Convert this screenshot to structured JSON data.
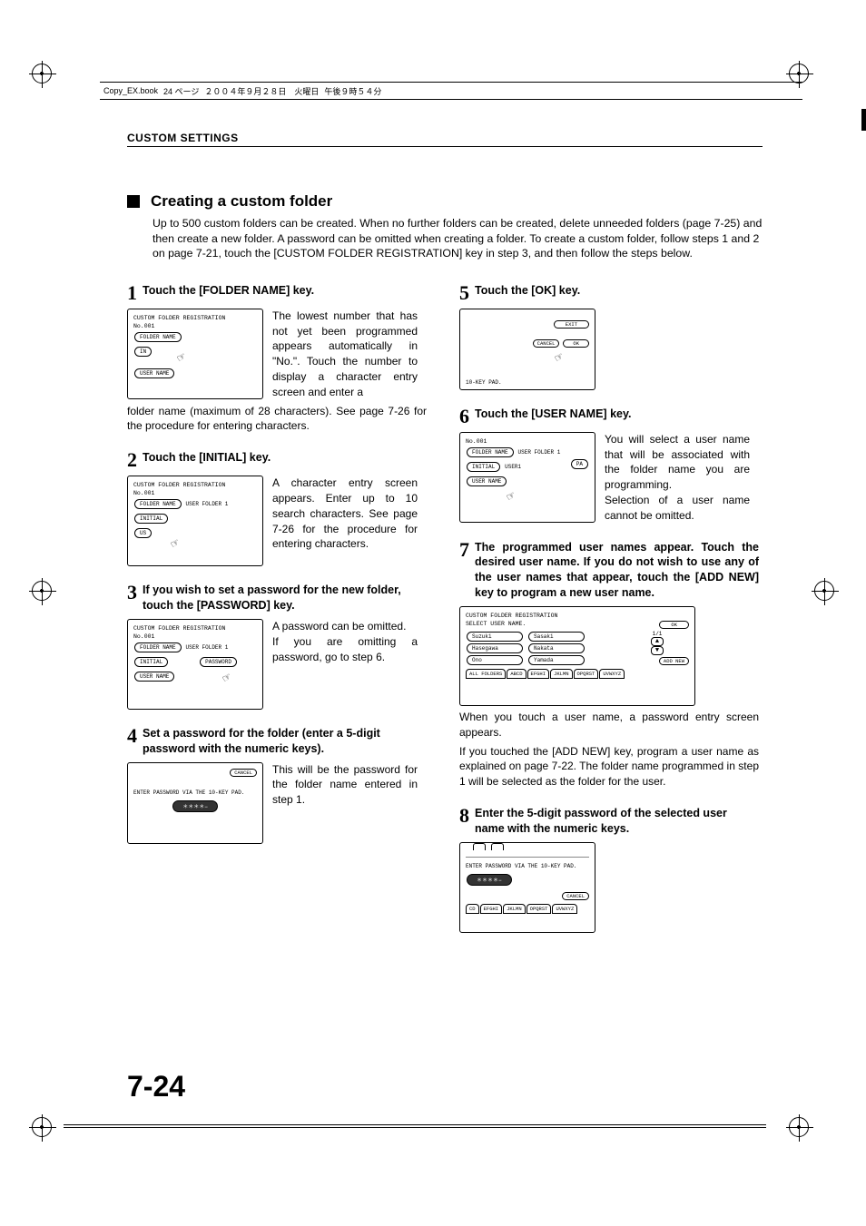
{
  "header": {
    "file": "Copy_EX.book",
    "page_info": "24 ページ",
    "date": "２００４年９月２８日　火曜日",
    "time": "午後９時５４分"
  },
  "section_header": "CUSTOM SETTINGS",
  "heading": "Creating a custom folder",
  "intro": "Up to 500 custom folders can be created. When no further folders can be created, delete unneeded folders (page 7-25) and then create a new folder. A password can be omitted when creating a folder. To create a custom folder, follow steps 1 and 2 on page 7-21, touch the [CUSTOM FOLDER REGISTRATION] key in step 3, and then follow the steps below.",
  "steps": {
    "s1": {
      "num": "1",
      "title": "Touch the [FOLDER NAME] key.",
      "para1": "The lowest number that has not yet been programmed appears automatically in \"No.\". Touch the number to display a character entry screen and enter a",
      "para2": "folder name (maximum of 28 characters). See page 7-26 for the procedure for entering characters.",
      "shot": {
        "title": "CUSTOM FOLDER REGISTRATION",
        "no": "No.001",
        "folder_name": "FOLDER NAME",
        "initial_prefix": "IN",
        "user_name": "USER NAME"
      }
    },
    "s2": {
      "num": "2",
      "title": "Touch the [INITIAL] key.",
      "para": "A character entry screen appears. Enter up to 10 search characters. See page 7-26 for the procedure for entering characters.",
      "shot": {
        "title": "CUSTOM FOLDER REGISTRATION",
        "no": "No.001",
        "folder_name": "FOLDER NAME",
        "folder_value": "USER FOLDER 1",
        "initial": "INITIAL",
        "us_prefix": "US"
      }
    },
    "s3": {
      "num": "3",
      "title": "If you wish to set a password for the new folder, touch the [PASSWORD] key.",
      "para": "A password can be omitted.\nIf you are omitting a password, go to step 6.",
      "shot": {
        "title": "CUSTOM FOLDER REGISTRATION",
        "no": "No.001",
        "folder_name": "FOLDER NAME",
        "folder_value": "USER FOLDER 1",
        "initial": "INITIAL",
        "password": "PASSWORD",
        "user_name": "USER NAME"
      }
    },
    "s4": {
      "num": "4",
      "title": "Set a password for the folder (enter a 5-digit password with the numeric keys).",
      "para": "This will be the password for the folder name entered in step 1.",
      "shot": {
        "cancel": "CANCEL",
        "prompt": "ENTER PASSWORD VIA THE 10-KEY PAD.",
        "stars": "＊＊＊＊−"
      }
    },
    "s5": {
      "num": "5",
      "title": "Touch the [OK] key.",
      "shot": {
        "exit": "EXIT",
        "cancel": "CANCEL",
        "ok": "OK",
        "tenkey": "10-KEY PAD."
      }
    },
    "s6": {
      "num": "6",
      "title": "Touch the [USER NAME] key.",
      "para": "You will select a user name that will be associated with the folder name you are programming.\nSelection of a user name cannot be omitted.",
      "shot": {
        "no": "No.001",
        "folder_name": "FOLDER NAME",
        "folder_value": "USER FOLDER 1",
        "initial": "INITIAL",
        "initial_value": "USER1",
        "pa_suffix": "PA",
        "user_name": "USER NAME"
      }
    },
    "s7": {
      "num": "7",
      "title": "The programmed user names appear. Touch the desired user name. If you do not wish to use any of the user names that appear, touch the [ADD NEW] key to program a new user name.",
      "para1": "When you touch a user name, a password entry screen appears.",
      "para2": "If you touched the [ADD NEW] key, program a user name as explained on page 7-22. The folder name programmed in step 1 will be selected as the folder for the user.",
      "shot": {
        "title": "CUSTOM FOLDER REGISTRATION",
        "subtitle": "SELECT USER NAME.",
        "ok": "OK",
        "users": [
          "Suzuki",
          "Sasaki",
          "Hasegawa",
          "Nakata",
          "Ono",
          "Yamada"
        ],
        "page": "1/1",
        "add_new": "ADD NEW",
        "tabs": [
          "ALL FOLDERS",
          "ABCD",
          "EFGHI",
          "JKLMN",
          "OPQRST",
          "UVWXYZ"
        ]
      }
    },
    "s8": {
      "num": "8",
      "title": "Enter the 5-digit password of the selected user name with the numeric keys.",
      "shot": {
        "prompt": "ENTER PASSWORD VIA THE 10-KEY PAD.",
        "stars": "＊＊＊＊−",
        "cancel": "CANCEL",
        "tabs": [
          "CD",
          "EFGHI",
          "JKLMN",
          "OPQRST",
          "UVWXYZ"
        ]
      }
    }
  },
  "page_number": "7-24"
}
